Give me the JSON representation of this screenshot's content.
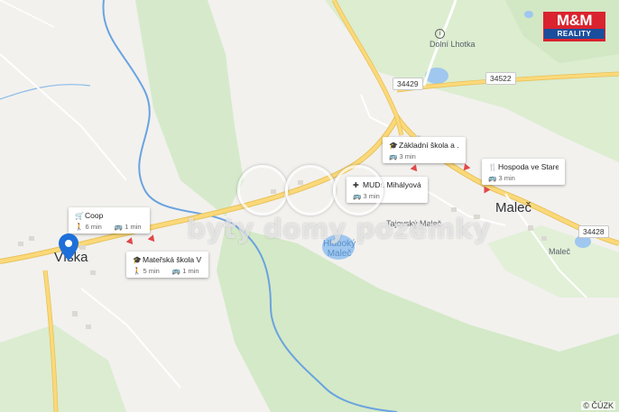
{
  "map": {
    "places": {
      "viska": "Víska",
      "malec": "Maleč",
      "dolni_lhotka": "Dolní Lhotka",
      "malec_small": "Maleč",
      "hluboky_malec": "Hluboký\nMaleč",
      "tajovsky_malec": "Tajovský Maleč"
    },
    "roads": {
      "r1": "34429",
      "r2": "34522",
      "r3": "34428"
    },
    "poi_cards": [
      {
        "icon": "cart-icon",
        "title": "Coop",
        "walk": "6 min",
        "drive": "1 min"
      },
      {
        "icon": "graduation-cap-icon",
        "title": "Mateřská škola Ví...",
        "walk": "5 min",
        "drive": "1 min"
      },
      {
        "icon": "graduation-cap-icon",
        "title": "Základní škola a ...",
        "drive": "3 min"
      },
      {
        "icon": "medical-icon",
        "title": "MUDr. Mihályová ...",
        "drive": "3 min"
      },
      {
        "icon": "fork-knife-icon",
        "title": "Hospoda ve Stare...",
        "drive": "3 min"
      }
    ],
    "logo": {
      "line1": "M&M",
      "line2": "REALITY"
    },
    "watermark": "byty domy pozemky",
    "copyright": "© ČÚZK",
    "colors": {
      "water": "#9fc7ef",
      "river": "#6aa3e0",
      "road": "#fbd97a",
      "forest": "#cfe6c1",
      "pin": "#1e6fd9"
    }
  }
}
